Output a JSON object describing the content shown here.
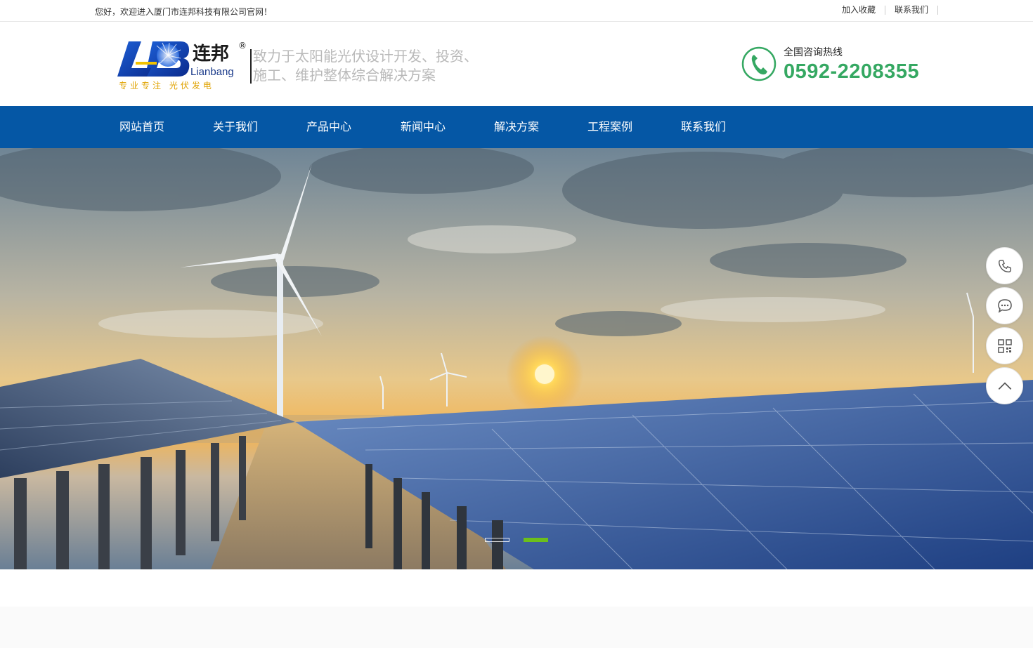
{
  "topbar": {
    "welcome": "您好，欢迎进入厦门市连邦科技有限公司官网！",
    "links": [
      "加入收藏",
      "联系我们"
    ]
  },
  "header": {
    "logo": {
      "cn": "连邦",
      "en": "Lianbang",
      "tagline": "专业专注  光伏发电",
      "mark": "®"
    },
    "slogan_line1": "致力于太阳能光伏设计开发、投资、",
    "slogan_line2": "施工、维护整体综合解决方案",
    "hotline_label": "全国咨询热线",
    "hotline_number": "0592-2208355",
    "hotline_icon": "phone-icon"
  },
  "nav": {
    "items": [
      "网站首页",
      "关于我们",
      "产品中心",
      "新闻中心",
      "解决方案",
      "工程案例",
      "联系我们"
    ]
  },
  "banner": {
    "slides": 2,
    "active_slide": 2
  },
  "float_bar": {
    "icons": [
      "phone-icon",
      "chat-icon",
      "qrcode-icon",
      "arrow-up-icon"
    ]
  },
  "colors": {
    "nav_bg": "#0557a5",
    "hotline": "#35a862",
    "dot_active": "#6cbf1b",
    "slogan": "#b9b9b9"
  }
}
